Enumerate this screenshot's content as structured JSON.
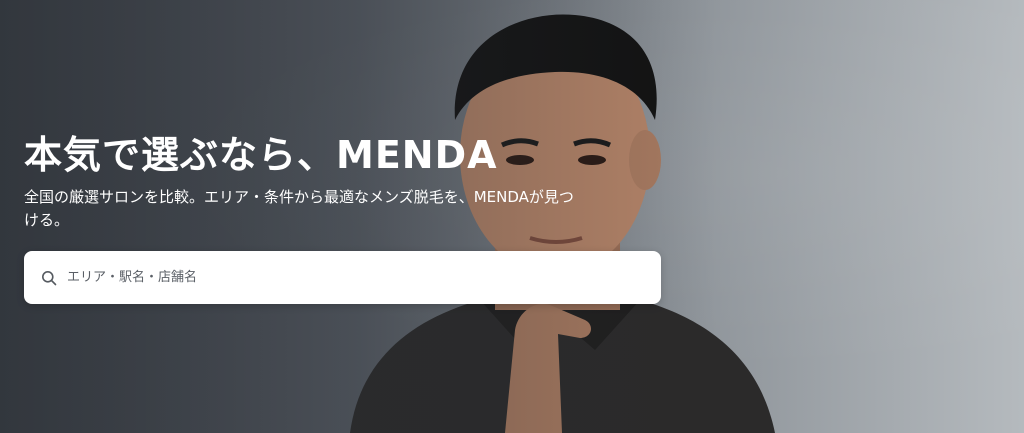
{
  "hero": {
    "headline": "本気で選ぶなら、MENDA",
    "subtext": "全国の厳選サロンを比較。エリア・条件から最適なメンズ脱毛を、MENDAが見つける。",
    "background_image": "man-portrait-photo"
  },
  "search": {
    "placeholder": "エリア・駅名・店舗名",
    "icon": "search-icon"
  },
  "colors": {
    "headline_text": "#ffffff",
    "search_background": "#ffffff",
    "placeholder_text": "#5a5f66"
  }
}
